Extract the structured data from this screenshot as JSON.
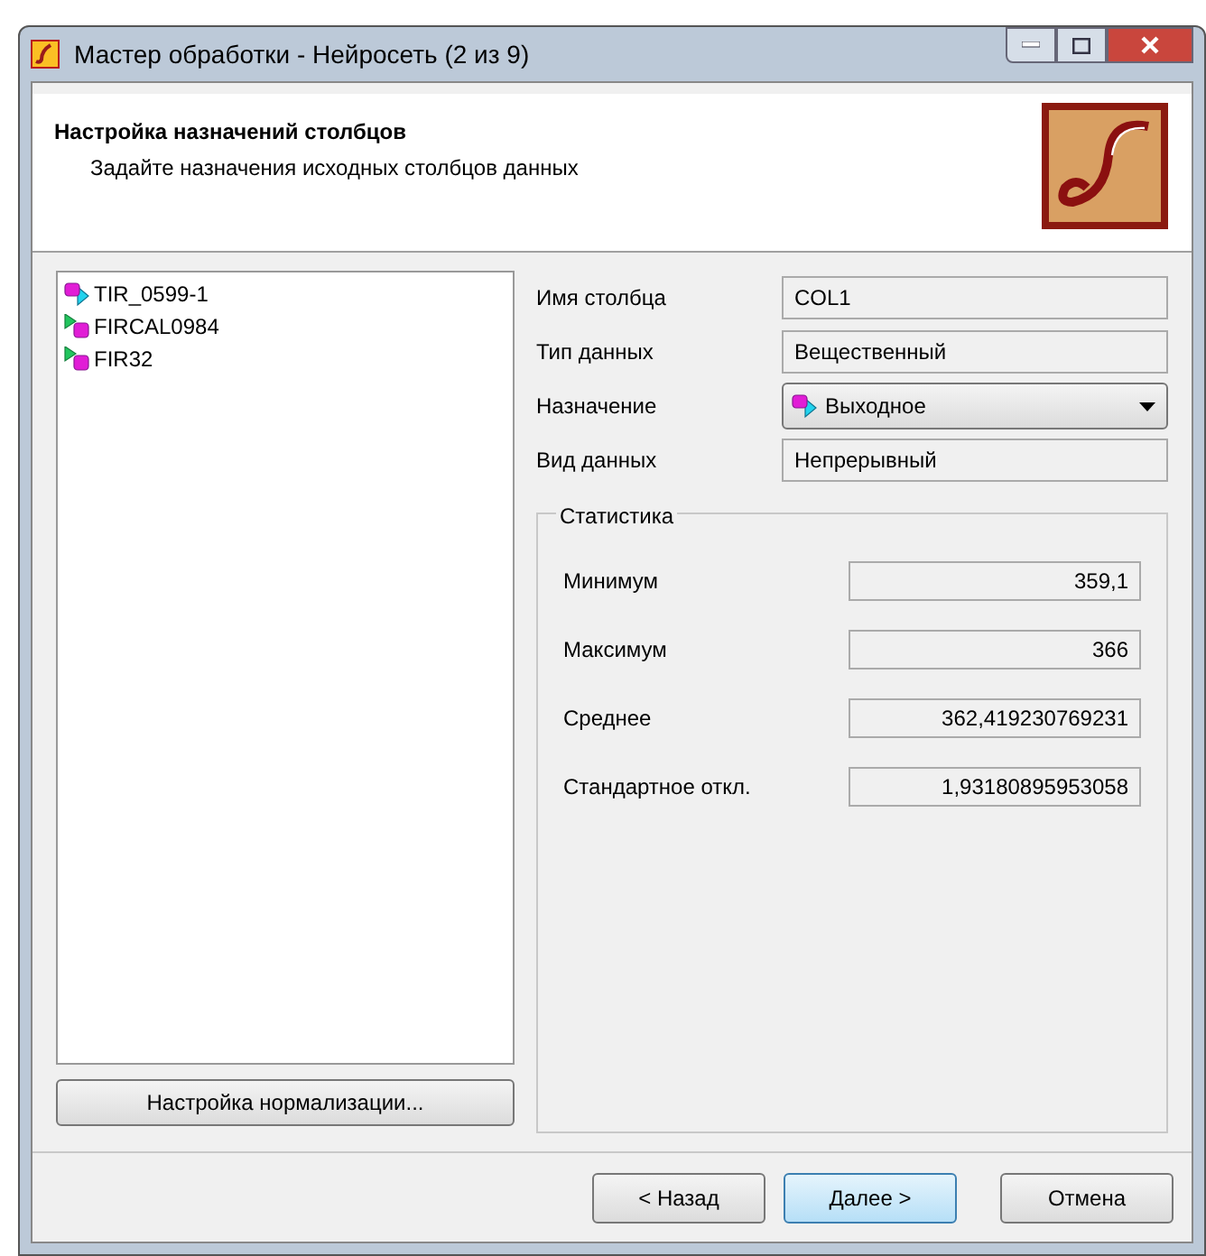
{
  "window": {
    "title": "Мастер обработки - Нейросеть (2 из 9)"
  },
  "header": {
    "title": "Настройка назначений столбцов",
    "subtitle": "Задайте назначения исходных столбцов данных"
  },
  "columns": [
    {
      "name": "TIR_0599-1",
      "kind": "output"
    },
    {
      "name": "FIRCAL0984",
      "kind": "input"
    },
    {
      "name": "FIR32",
      "kind": "input"
    }
  ],
  "normalize_button": "Настройка нормализации...",
  "fields": [
    {
      "label": "Имя столбца",
      "value": "COL1",
      "kind": "text"
    },
    {
      "label": "Тип данных",
      "value": "Вещественный",
      "kind": "text"
    },
    {
      "label": "Назначение",
      "value": "Выходное",
      "kind": "dropdown"
    },
    {
      "label": "Вид данных",
      "value": "Непрерывный",
      "kind": "text"
    }
  ],
  "statistics": {
    "title": "Статистика",
    "rows": [
      {
        "label": "Минимум",
        "value": "359,1"
      },
      {
        "label": "Максимум",
        "value": "366"
      },
      {
        "label": "Среднее",
        "value": "362,419230769231"
      },
      {
        "label": "Стандартное откл.",
        "value": "1,93180895953058"
      }
    ]
  },
  "buttons": [
    {
      "label": "< Назад",
      "selected": false
    },
    {
      "label": "Далее >",
      "selected": true
    },
    {
      "label": "Отмена",
      "selected": false
    }
  ]
}
